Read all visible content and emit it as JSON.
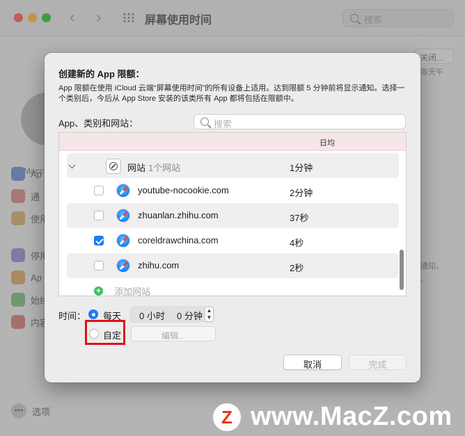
{
  "window": {
    "title": "屏幕使用时间",
    "search_placeholder": "搜索"
  },
  "background": {
    "account_label": "Macc",
    "sidebar_items": [
      "Ap",
      "通",
      "使用",
      "停用",
      "Ap",
      "始终",
      "内容"
    ],
    "options_label": "选项",
    "close_button": "关闭...",
    "sub_text": "每天午",
    "note_1": "通知。",
    "note_2": "-"
  },
  "sheet": {
    "title": "创建新的 App 限额：",
    "description": "App 限额在使用 iCloud 云端“屏幕使用时间”的所有设备上适用。达到限额 5 分钟前将显示通知。选择一个类别后，今后从 App Store 安装的该类所有 App 都将包括在限额中。",
    "section_label": "App、类别和网站：",
    "search_placeholder": "搜索",
    "column_header": "日均",
    "group": {
      "name": "网站",
      "count": "1个网站",
      "value": "1分钟"
    },
    "sites": [
      {
        "name": "youtube-nocookie.com",
        "value": "2分钟",
        "checked": false
      },
      {
        "name": "zhuanlan.zhihu.com",
        "value": "37秒",
        "checked": false
      },
      {
        "name": "coreldrawchina.com",
        "value": "4秒",
        "checked": true
      },
      {
        "name": "zhihu.com",
        "value": "2秒",
        "checked": false
      }
    ],
    "add_site": "添加网站",
    "time_label": "时间：",
    "daily_label": "每天",
    "custom_label": "自定",
    "hours": "0 小时",
    "minutes": "0 分钟",
    "edit_button": "编辑...",
    "cancel_button": "取消",
    "done_button": "完成"
  },
  "watermark": {
    "logo": "Z",
    "text": "www.MacZ.com"
  },
  "colors": {
    "accent": "#1a7cf5",
    "highlight": "#e0101b",
    "header_bg": "#f6e5e6"
  }
}
